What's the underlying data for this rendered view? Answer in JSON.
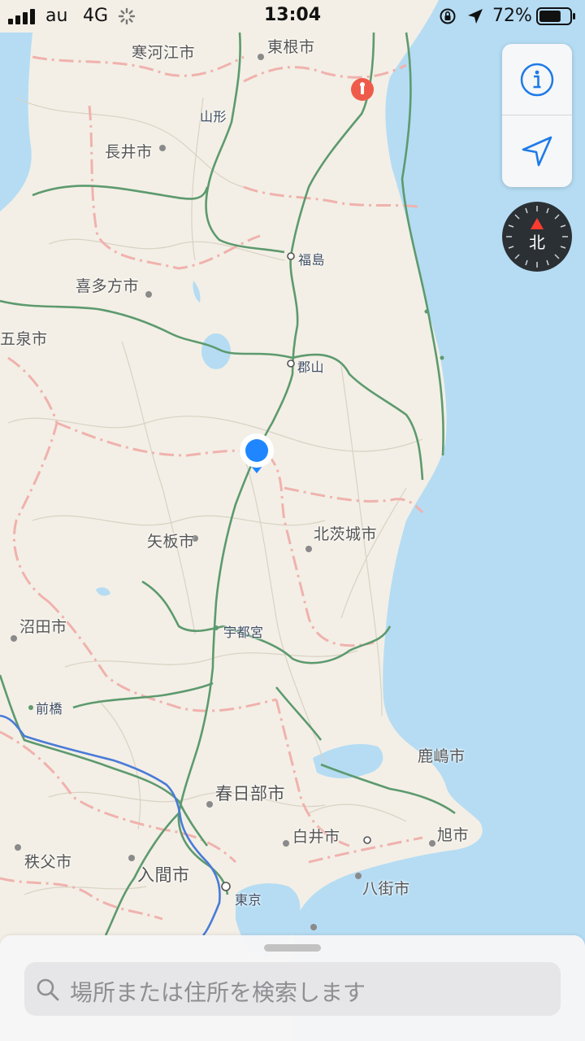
{
  "status_bar": {
    "carrier": "au",
    "network": "4G",
    "time": "13:04",
    "battery_percent": "72%",
    "battery_level": 0.72
  },
  "map": {
    "cities": {
      "sakaegawa": "寒河江市",
      "higashine": "東根市",
      "yamagata": "山形",
      "nagai": "長井市",
      "fukushima": "福島",
      "kitakata": "喜多方市",
      "gosen": "五泉市",
      "koriyama": "郡山",
      "yaita": "矢板市",
      "kitaibaraki": "北茨城市",
      "numata": "沼田市",
      "utsunomiya": "宇都宮",
      "maebashi": "前橋",
      "kashima": "鹿嶋市",
      "kasukabe": "春日部市",
      "shiroi": "白井市",
      "asahi": "旭市",
      "chichibu": "秩父市",
      "iruma": "入間市",
      "tokyo": "東京",
      "yachimata": "八街市"
    }
  },
  "controls": {
    "info_icon": "info-icon",
    "location_icon": "location-arrow-icon",
    "compass_label": "北"
  },
  "search": {
    "placeholder": "場所または住所を検索します",
    "icon": "search-icon"
  },
  "colors": {
    "sea": "#b5dcf3",
    "land": "#f3efe6",
    "highway": "#5d9a6e",
    "prefecture_border": "#f0b2ad",
    "route": "#4a7bd8",
    "user_location": "#1f86ff",
    "pin": "#ef5b4a"
  }
}
